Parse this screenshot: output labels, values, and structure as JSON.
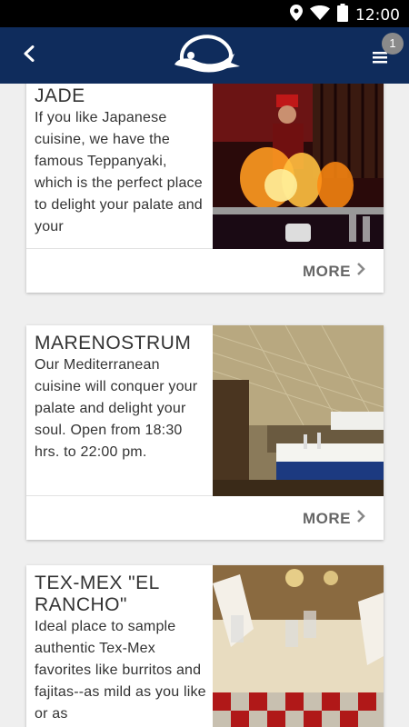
{
  "status_bar": {
    "time": "12:00"
  },
  "header": {
    "notification_count": "1"
  },
  "restaurants": [
    {
      "title": "JADE",
      "description": "If you like Japanese cuisine, we have the famous Teppanyaki, which is the perfect place to delight your palate and your",
      "more_label": "MORE"
    },
    {
      "title": "MARENOSTRUM",
      "description": "Our Mediterranean cuisine will conquer your palate and delight your soul. Open from 18:30 hrs. to 22:00 pm.",
      "more_label": "MORE"
    },
    {
      "title": "TEX-MEX \"EL RANCHO\"",
      "description": "Ideal place to sample authentic Tex-Mex favorites like burritos and fajitas--as mild as you like or as",
      "more_label": "MORE"
    }
  ]
}
